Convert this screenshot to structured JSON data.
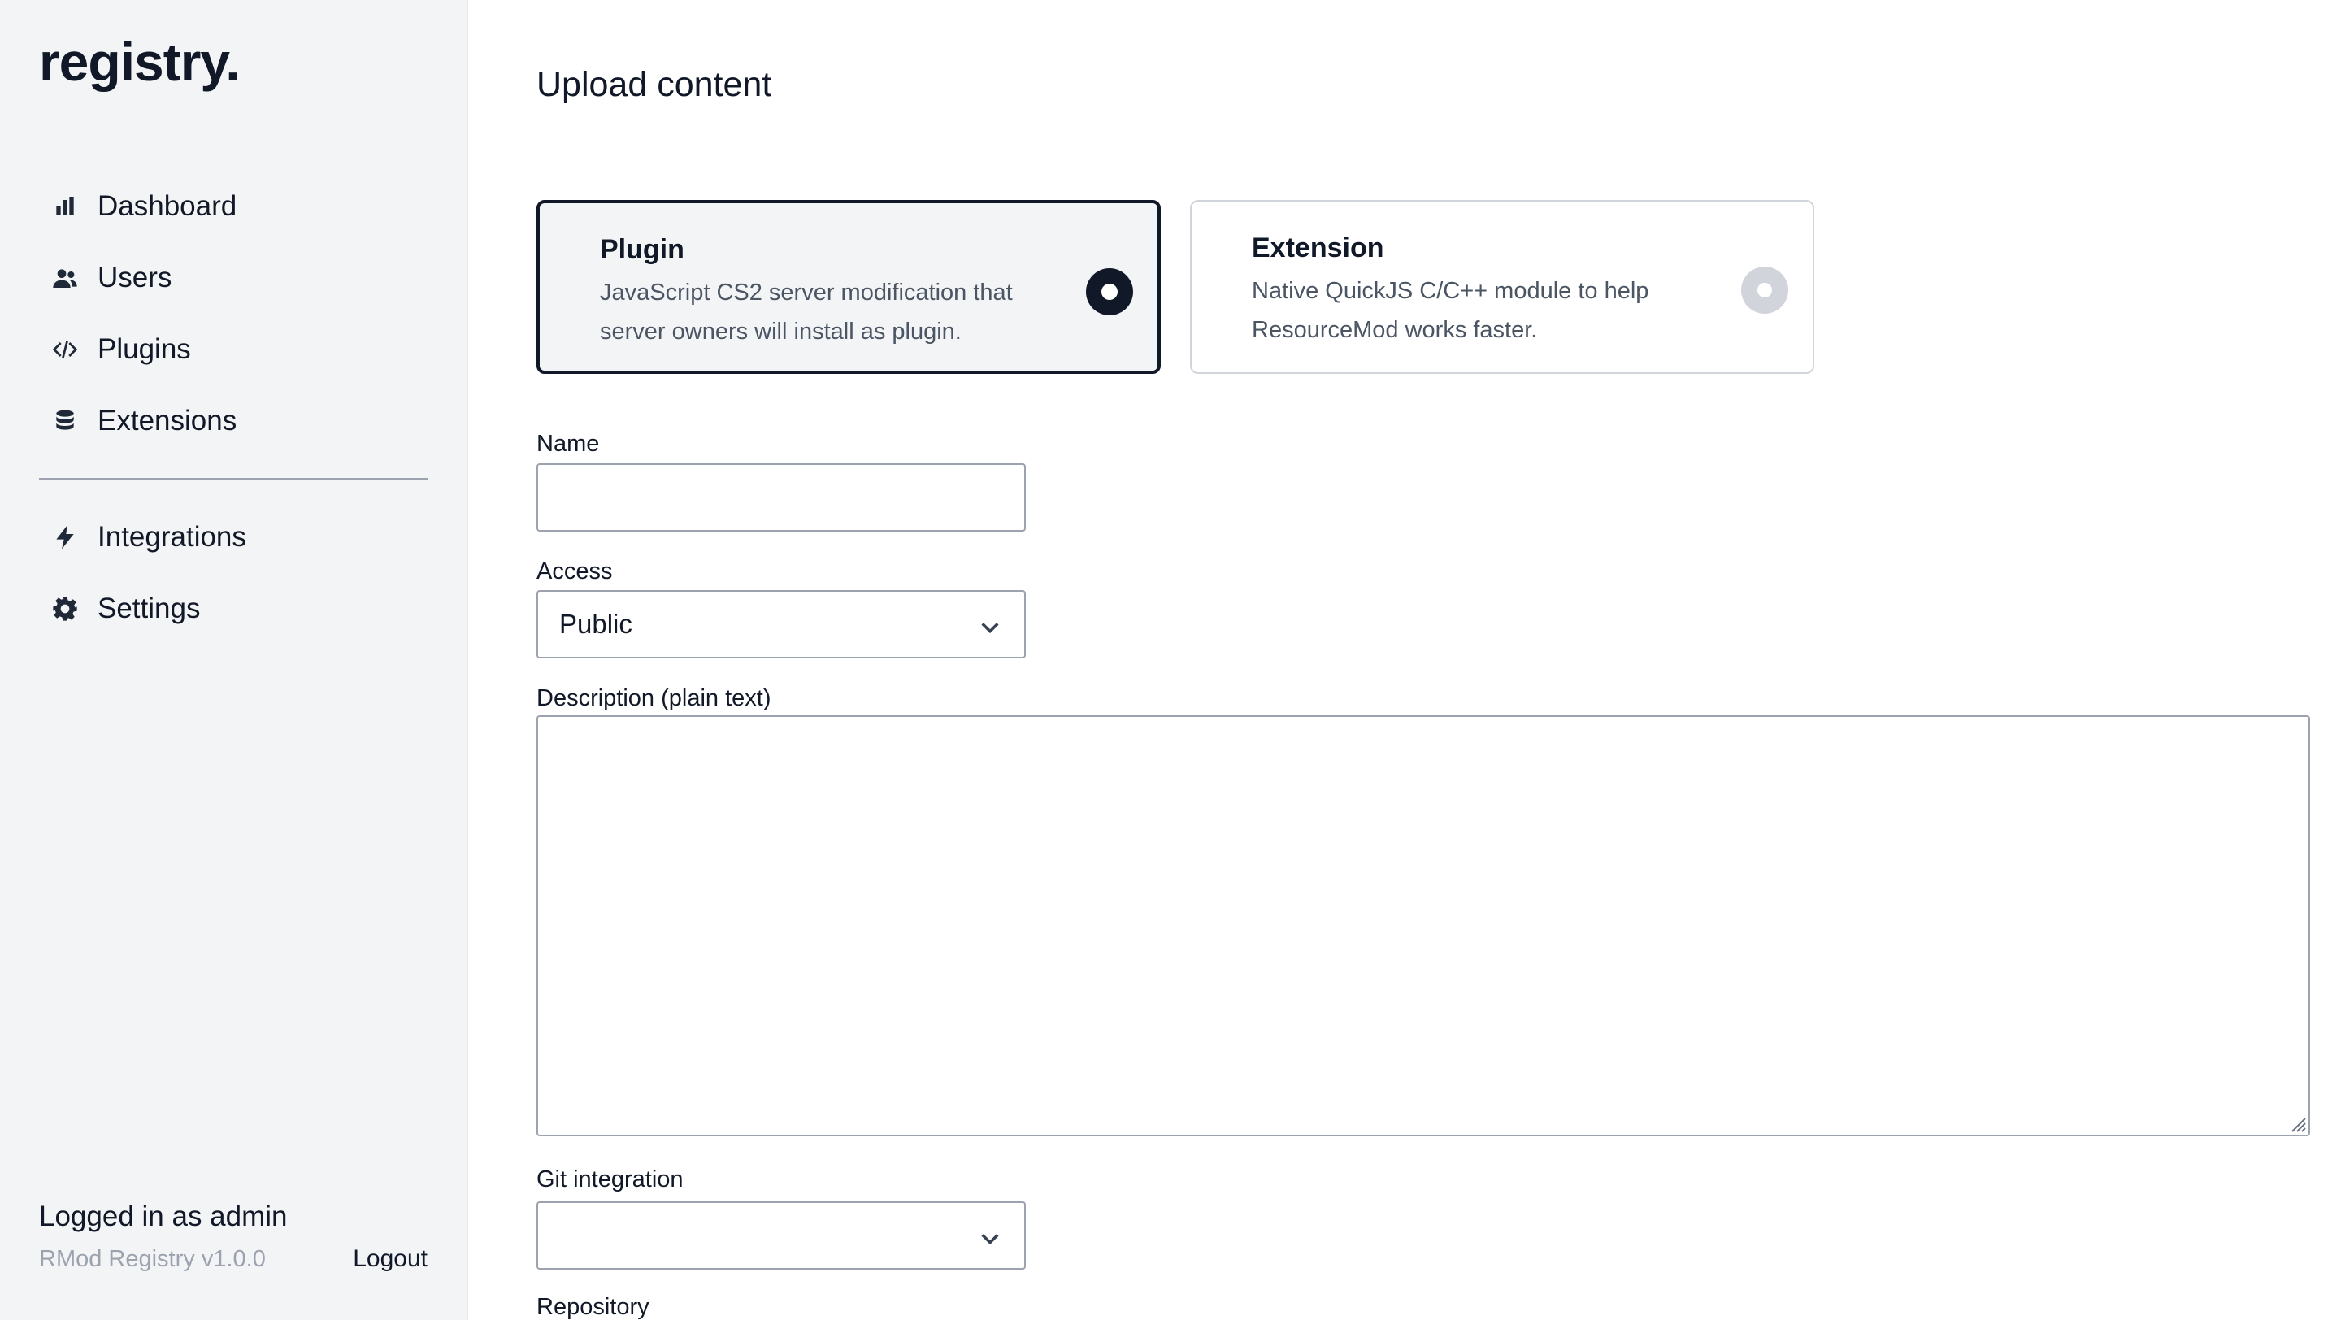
{
  "sidebar": {
    "brand": "registry.",
    "items": [
      {
        "label": "Dashboard",
        "icon": "bar-chart-icon"
      },
      {
        "label": "Users",
        "icon": "users-icon"
      },
      {
        "label": "Plugins",
        "icon": "code-icon"
      },
      {
        "label": "Extensions",
        "icon": "database-icon"
      },
      {
        "label": "Integrations",
        "icon": "bolt-icon"
      },
      {
        "label": "Settings",
        "icon": "gear-icon"
      }
    ],
    "footer": {
      "logged_in": "Logged in as admin",
      "version": "RMod Registry v1.0.0",
      "logout": "Logout"
    }
  },
  "main": {
    "title": "Upload content",
    "types": [
      {
        "title": "Plugin",
        "description": "JavaScript CS2 server modification that server owners will install as plugin.",
        "selected": true
      },
      {
        "title": "Extension",
        "description": "Native QuickJS C/C++ module to help ResourceMod works faster.",
        "selected": false
      }
    ],
    "fields": {
      "name": {
        "label": "Name",
        "value": ""
      },
      "access": {
        "label": "Access",
        "value": "Public"
      },
      "description": {
        "label": "Description (plain text)",
        "value": ""
      },
      "git_integration": {
        "label": "Git integration",
        "value": ""
      },
      "repository": {
        "label": "Repository"
      }
    }
  },
  "colors": {
    "sidebar_bg": "#f3f4f6",
    "selected_border": "#111827",
    "muted_text": "#9ca3af"
  }
}
